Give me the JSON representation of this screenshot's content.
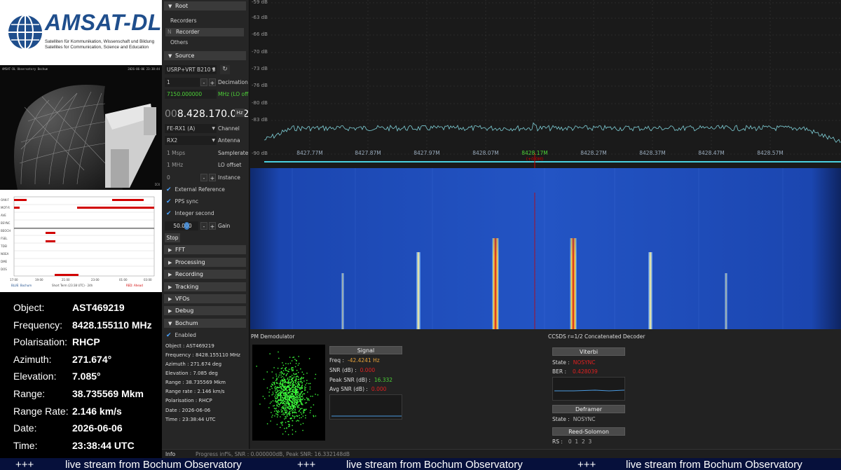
{
  "logo": {
    "title": "AMSAT-DL",
    "subtitle_lines": [
      "Satelliten für Kommunikation, Wissenschaft und Bildung",
      "Satellites for Communication, Science and Education"
    ]
  },
  "camera": {
    "overlay_left": "AMSAT-DL Observatory Bochum",
    "overlay_right": "2026-06-06 23:38:44",
    "corner": "ICX"
  },
  "timeline": {
    "rows": [
      "OAK-F",
      "MOT-R",
      "AVE",
      "BSYNC",
      "BEOCH",
      "FSEL",
      "TDEI",
      "NOEA",
      "DME",
      "DOS"
    ],
    "x_ticks": [
      "17:00",
      "19:00",
      "21:00",
      "23:00",
      "01:00",
      "03:00"
    ],
    "footer_left": "BLUE: Bochum",
    "footer_mid": "Short Term (23:38 UTC) · 24h",
    "footer_right": "RED: Ahead"
  },
  "info": {
    "object": {
      "label": "Object:",
      "value": "AST469219"
    },
    "frequency": {
      "label": "Frequency:",
      "value": "8428.155110 MHz"
    },
    "polarisation": {
      "label": "Polarisation:",
      "value": "RHCP"
    },
    "azimuth": {
      "label": "Azimuth:",
      "value": "271.674°"
    },
    "elevation": {
      "label": "Elevation:",
      "value": "7.085°"
    },
    "range": {
      "label": "Range:",
      "value": "38.735569 Mkm"
    },
    "range_rate": {
      "label": "Range Rate:",
      "value": "2.146 km/s"
    },
    "date": {
      "label": "Date:",
      "value": "2026-06-06"
    },
    "time": {
      "label": "Time:",
      "value": "23:38:44 UTC"
    }
  },
  "panel": {
    "root": "Root",
    "recorders": "Recorders",
    "recorder_prefix": "N",
    "recorder": "Recorder",
    "others": "Others",
    "source": "Source",
    "device": "USRP+VRT B210 3",
    "decimation_value": "1",
    "decimation_label": "Decimation",
    "lo_freq": "7150.000000",
    "lo_label": "MHz (LO off",
    "freq_prefix": "00",
    "freq_main": "8.428.170.032",
    "freq_unit": "Hz",
    "channel_value": "FE-RX1 (A)",
    "channel_label": "Channel",
    "antenna_value": "RX2",
    "antenna_label": "Antenna",
    "samplerate_value": "1 Msps",
    "samplerate_label": "Samplerate",
    "lo_offset_value": "1 MHz",
    "lo_offset_label": "LO offset",
    "instance_value": "0",
    "instance_label": "Instance",
    "ext_ref": "External Reference",
    "pps": "PPS sync",
    "int_sec": "Integer second",
    "gain_value": "50.000",
    "gain_label": "Gain",
    "stop": "Stop",
    "fft": "FFT",
    "processing": "Processing",
    "recording": "Recording",
    "tracking": "Tracking",
    "vfos": "VFOs",
    "debug": "Debug",
    "bochum": "Bochum",
    "enabled": "Enabled",
    "bochum_lines": [
      "Object : AST469219",
      "Frequency : 8428.155110 MHz",
      "Azimuth : 271.674 deg",
      "Elevation : 7.085 deg",
      "Range : 38.735569 Mkm",
      "Range rate : 2.146 km/s",
      "Polarisation : RHCP",
      "Date : 2026-06-06",
      "Time : 23:38:44 UTC"
    ]
  },
  "spectrum": {
    "db_labels": [
      "-59 dB",
      "-63 dB",
      "-66 dB",
      "-70 dB",
      "-73 dB",
      "-76 dB",
      "-80 dB",
      "-83 dB",
      "-90 dB"
    ],
    "freq_labels": [
      "8427.77M",
      "8427.87M",
      "8427.97M",
      "8428.07M",
      "8428.17M",
      "8428.27M",
      "8428.37M",
      "8428.47M",
      "8428.57M"
    ],
    "center_marker": "8428.17M",
    "center_sub": "(+0.0M)"
  },
  "demod": {
    "pm_title": "PM Demodulator",
    "signal": "Signal",
    "freq_label": "Freq :",
    "freq_value": "-42.4241 Hz",
    "snr_label": "SNR (dB) :",
    "snr_value": "0.000",
    "peak_label": "Peak SNR (dB) :",
    "peak_value": "16.332",
    "avg_label": "Avg SNR (dB) :",
    "avg_value": "0.000",
    "ccsds_title": "CCSDS r=1/2 Concatenated Decoder",
    "viterbi": "Viterbi",
    "state_label": "State :",
    "viterbi_state": "NOSYNC",
    "ber_label": "BER :",
    "ber_value": "0.428039",
    "deframer": "Deframer",
    "deframer_state": "NOSYNC",
    "reed": "Reed-Solomon",
    "rs_label": "RS :",
    "rs_values": "0  1  2  3"
  },
  "status": {
    "label": "Info",
    "text": "Progress inf%, SNR : 0.000000dB, Peak SNR: 16.332148dB"
  },
  "ticker": {
    "plus": "+++",
    "text": "live stream from Bochum Observatory"
  },
  "colors": {
    "accent_green": "#4cd137",
    "warn_red": "#e02020",
    "freq_orange": "#e8a33a",
    "ticker_bg": "#06103b"
  }
}
